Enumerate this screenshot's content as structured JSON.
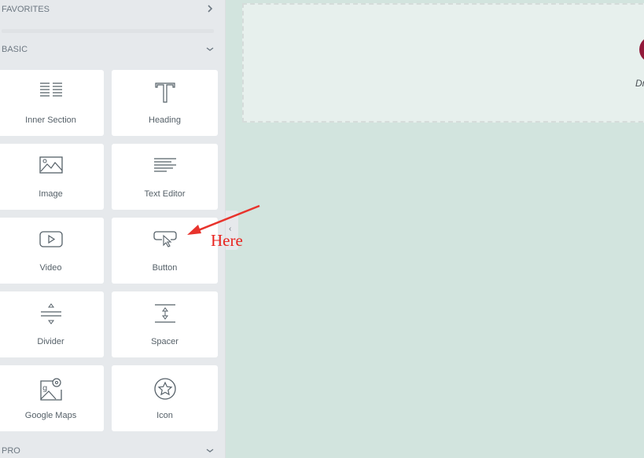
{
  "panel": {
    "categories": [
      {
        "label": "FAVORITES",
        "state": "collapsed"
      },
      {
        "label": "BASIC",
        "state": "expanded"
      },
      {
        "label": "PRO",
        "state": "expanded"
      }
    ],
    "widgets": [
      {
        "label": "Inner Section",
        "icon": "inner-section-icon"
      },
      {
        "label": "Heading",
        "icon": "heading-icon"
      },
      {
        "label": "Image",
        "icon": "image-icon"
      },
      {
        "label": "Text Editor",
        "icon": "text-editor-icon"
      },
      {
        "label": "Video",
        "icon": "video-icon"
      },
      {
        "label": "Button",
        "icon": "button-icon"
      },
      {
        "label": "Divider",
        "icon": "divider-icon"
      },
      {
        "label": "Spacer",
        "icon": "spacer-icon"
      },
      {
        "label": "Google Maps",
        "icon": "google-maps-icon"
      },
      {
        "label": "Icon",
        "icon": "star-icon"
      }
    ]
  },
  "canvas": {
    "partial_text": "Dr",
    "accent": "#921a3a",
    "background": "#d2e4de"
  },
  "annotation": {
    "text": "Here",
    "color": "#e8231f"
  }
}
